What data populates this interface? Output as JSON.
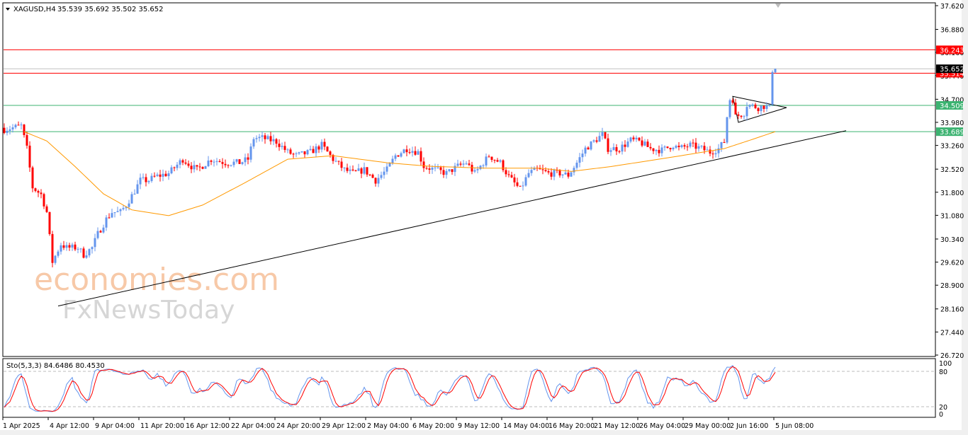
{
  "header": {
    "symbol": "XAGUSD,H4",
    "ohlc": "35.539 35.692 35.502 35.652"
  },
  "indicator": {
    "label": "Sto(5,3,3) 84.6486 80.4530",
    "levels": [
      "100",
      "80",
      "20",
      "0"
    ]
  },
  "watermark": {
    "line1": "economies.com",
    "line2": "FxNewsToday"
  },
  "colors": {
    "bull": "#6495ed",
    "bear": "#ff0000",
    "ma": "#ff9900",
    "resistance": "#ff0000",
    "support": "#3cb371",
    "trend": "#000000",
    "stoch_main": "#6495ed",
    "stoch_signal": "#ff0000"
  },
  "chart_data": {
    "type": "candlestick",
    "title": "XAGUSD,H4",
    "price_ticks": [
      "37.620",
      "36.880",
      "36.160",
      "35.440",
      "34.700",
      "33.980",
      "33.260",
      "32.520",
      "31.800",
      "31.080",
      "30.340",
      "29.620",
      "28.900",
      "28.160",
      "27.440",
      "26.720"
    ],
    "ylim": [
      26.72,
      37.62
    ],
    "time_labels": [
      "1 Apr 2025",
      "4 Apr 12:00",
      "9 Apr 04:00",
      "11 Apr 20:00",
      "16 Apr 12:00",
      "22 Apr 04:00",
      "24 Apr 20:00",
      "29 Apr 12:00",
      "2 May 04:00",
      "6 May 20:00",
      "9 May 12:00",
      "14 May 04:00",
      "16 May 20:00",
      "21 May 12:00",
      "26 May 04:00",
      "29 May 00:00",
      "2 Jun 16:00",
      "5 Jun 08:00"
    ],
    "bars_per_label": 16,
    "close_knots": [
      [
        0,
        33.76
      ],
      [
        6,
        33.87
      ],
      [
        8,
        33.16
      ],
      [
        10,
        31.95
      ],
      [
        13,
        31.73
      ],
      [
        15,
        31.18
      ],
      [
        17,
        29.63
      ],
      [
        20,
        30.18
      ],
      [
        22,
        30.07
      ],
      [
        26,
        30.07
      ],
      [
        28,
        29.85
      ],
      [
        31,
        30.07
      ],
      [
        33,
        30.5
      ],
      [
        36,
        30.96
      ],
      [
        38,
        31.18
      ],
      [
        41,
        31.18
      ],
      [
        43,
        31.4
      ],
      [
        46,
        31.84
      ],
      [
        48,
        32.17
      ],
      [
        51,
        32.17
      ],
      [
        53,
        32.28
      ],
      [
        58,
        32.39
      ],
      [
        63,
        32.83
      ],
      [
        66,
        32.61
      ],
      [
        68,
        32.5
      ],
      [
        73,
        32.83
      ],
      [
        78,
        32.72
      ],
      [
        83,
        32.72
      ],
      [
        86,
        32.83
      ],
      [
        88,
        33.49
      ],
      [
        91,
        33.49
      ],
      [
        96,
        33.38
      ],
      [
        100,
        33.05
      ],
      [
        103,
        32.94
      ],
      [
        108,
        33.05
      ],
      [
        112,
        33.27
      ],
      [
        116,
        32.83
      ],
      [
        120,
        32.5
      ],
      [
        123,
        32.39
      ],
      [
        127,
        32.5
      ],
      [
        131,
        32.17
      ],
      [
        135,
        32.5
      ],
      [
        138,
        32.94
      ],
      [
        142,
        33.16
      ],
      [
        146,
        33.05
      ],
      [
        148,
        32.61
      ],
      [
        152,
        32.5
      ],
      [
        156,
        32.39
      ],
      [
        160,
        32.61
      ],
      [
        163,
        32.72
      ],
      [
        166,
        32.39
      ],
      [
        171,
        32.94
      ],
      [
        175,
        32.72
      ],
      [
        178,
        32.28
      ],
      [
        182,
        31.88
      ],
      [
        185,
        32.39
      ],
      [
        188,
        32.5
      ],
      [
        192,
        32.39
      ],
      [
        196,
        32.39
      ],
      [
        199,
        32.33
      ],
      [
        202,
        32.72
      ],
      [
        205,
        33.16
      ],
      [
        208,
        33.38
      ],
      [
        211,
        33.6
      ],
      [
        213,
        33.16
      ],
      [
        217,
        33.16
      ],
      [
        221,
        33.42
      ],
      [
        224,
        33.38
      ],
      [
        228,
        33.16
      ],
      [
        232,
        33.11
      ],
      [
        236,
        33.27
      ],
      [
        238,
        33.16
      ],
      [
        242,
        33.27
      ],
      [
        246,
        33.16
      ],
      [
        249,
        33.05
      ],
      [
        252,
        33.16
      ],
      [
        254,
        33.38
      ],
      [
        255,
        34.16
      ],
      [
        256,
        34.7
      ],
      [
        257,
        34.7
      ],
      [
        258,
        34.16
      ],
      [
        261,
        34.27
      ],
      [
        262,
        34.53
      ],
      [
        264,
        34.49
      ],
      [
        266,
        34.44
      ],
      [
        268,
        34.49
      ],
      [
        270,
        34.44
      ],
      [
        271,
        35.55
      ],
      [
        272,
        35.65
      ]
    ],
    "ma_knots": [
      [
        7,
        33.69
      ],
      [
        15,
        33.4
      ],
      [
        25,
        32.6
      ],
      [
        35,
        31.75
      ],
      [
        45,
        31.25
      ],
      [
        58,
        31.07
      ],
      [
        70,
        31.4
      ],
      [
        85,
        32.1
      ],
      [
        100,
        32.83
      ],
      [
        116,
        32.94
      ],
      [
        135,
        32.72
      ],
      [
        150,
        32.61
      ],
      [
        170,
        32.55
      ],
      [
        189,
        32.55
      ],
      [
        200,
        32.45
      ],
      [
        214,
        32.6
      ],
      [
        236,
        32.9
      ],
      [
        254,
        33.16
      ],
      [
        264,
        33.45
      ],
      [
        272,
        33.69
      ]
    ],
    "horizontal_levels": [
      {
        "price": 36.243,
        "label": "36.243",
        "kind": "resistance"
      },
      {
        "price": 35.514,
        "label": "35.514",
        "kind": "resistance"
      },
      {
        "price": 35.652,
        "label": "35.652",
        "kind": "bid"
      },
      {
        "price": 34.509,
        "label": "34.509",
        "kind": "support"
      },
      {
        "price": 33.689,
        "label": "33.689",
        "kind": "support"
      }
    ],
    "trendline": [
      [
        19,
        28.25
      ],
      [
        297,
        33.72
      ]
    ],
    "triangle": [
      [
        257,
        34.79
      ],
      [
        276,
        34.44
      ],
      [
        259,
        33.98
      ]
    ]
  }
}
